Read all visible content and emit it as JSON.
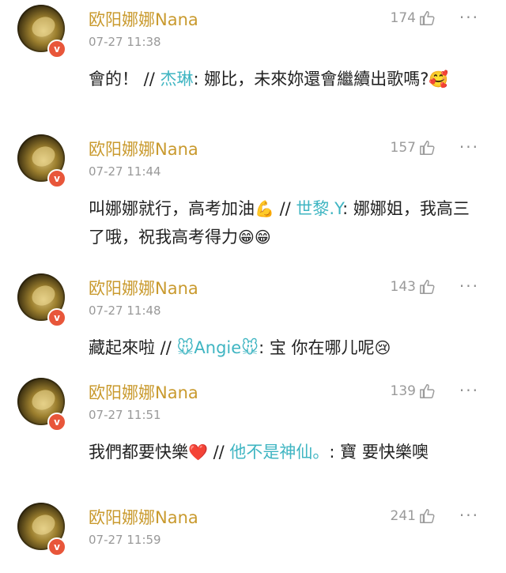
{
  "comments": [
    {
      "username": "欧阳娜娜Nana",
      "time": "07-27 11:38",
      "likes": "174",
      "text": "會的！ // ",
      "reply_user": "杰琳",
      "reply_text": ": 娜比，未來妳還會繼續出歌嗎?",
      "emoji": "🥰"
    },
    {
      "username": "欧阳娜娜Nana",
      "time": "07-27 11:44",
      "likes": "157",
      "text": "叫娜娜就行，高考加油",
      "emoji_mid": "💪",
      "text2": " // ",
      "reply_user": "世黎.Y",
      "reply_text": ": 娜娜姐，我高三了哦，祝我高考得力",
      "emoji": "😁😁"
    },
    {
      "username": "欧阳娜娜Nana",
      "time": "07-27 11:48",
      "likes": "143",
      "text": "藏起來啦 // ",
      "reply_user": "🐭Angie🐭",
      "reply_text": ": 宝 你在哪儿呢",
      "emoji": "😢"
    },
    {
      "username": "欧阳娜娜Nana",
      "time": "07-27 11:51",
      "likes": "139",
      "text": "我們都要快樂",
      "emoji_mid": "❤️",
      "text2": " // ",
      "reply_user": "他不是神仙。",
      "reply_text": ": 寶 要快樂噢"
    },
    {
      "username": "欧阳娜娜Nana",
      "time": "07-27 11:59",
      "likes": "241"
    }
  ],
  "icons": {
    "like": "thumbs-up-icon",
    "more": "more-dots-icon",
    "verified": "verified-badge-icon"
  },
  "colors": {
    "username": "#c99a2e",
    "reply_user": "#3fb5c2",
    "time": "#999999",
    "verified": "#e8563a"
  }
}
